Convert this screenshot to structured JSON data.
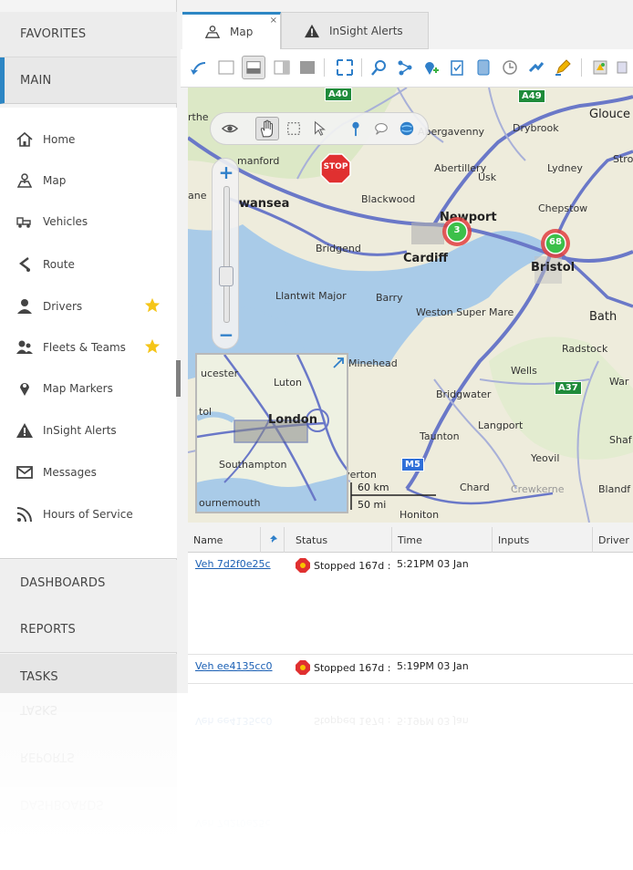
{
  "sidebar": {
    "favorites": "FAVORITES",
    "main": "MAIN",
    "items": [
      {
        "label": "Home",
        "icon": "home-icon"
      },
      {
        "label": "Map",
        "icon": "map-icon"
      },
      {
        "label": "Vehicles",
        "icon": "vehicles-icon"
      },
      {
        "label": "Route",
        "icon": "route-icon"
      },
      {
        "label": "Drivers",
        "icon": "driver-icon",
        "starred": true
      },
      {
        "label": "Fleets & Teams",
        "icon": "fleets-icon",
        "starred": true
      },
      {
        "label": "Map Markers",
        "icon": "map-marker-icon"
      },
      {
        "label": "InSight Alerts",
        "icon": "alert-icon"
      },
      {
        "label": "Messages",
        "icon": "envelope-icon"
      },
      {
        "label": "Hours of Service",
        "icon": "rss-icon"
      }
    ],
    "dashboards": "DASHBOARDS",
    "reports": "REPORTS",
    "tasks": "TASKS"
  },
  "tabs": {
    "map": "Map",
    "close": "×",
    "alerts": "InSight Alerts"
  },
  "map": {
    "stop_label": "STOP",
    "roads": {
      "a40": "A40",
      "a49": "A49",
      "a37": "A37",
      "m5": "M5"
    },
    "places": {
      "abergavenny": "Abergavenny",
      "glouce": "Glouce",
      "drybrook": "Drybrook",
      "rthe": "rthe",
      "manford": "manford",
      "abertillery": "Abertillery",
      "lydney": "Lydney",
      "stro": "Stro",
      "usk": "Usk",
      "wansea": "wansea",
      "blackwood": "Blackwood",
      "chepstow": "Chepstow",
      "newport": "Newport",
      "ane": "ane",
      "bridgend": "Bridgend",
      "cardiff": "Cardiff",
      "bristol": "Bristol",
      "llantwit": "Llantwit Major",
      "barry": "Barry",
      "weston": "Weston Super Mare",
      "bath": "Bath",
      "radstock": "Radstock",
      "minehead": "Minehead",
      "wells": "Wells",
      "war": "War",
      "bridgwater": "Bridgwater",
      "langport": "Langport",
      "taunton": "Taunton",
      "shaf": "Shaf",
      "yeovil": "Yeovil",
      "tiverton": "iverton",
      "chard": "Chard",
      "crewkerne": "Crewkerne",
      "blandf": "Blandf",
      "honiton": "Honiton"
    },
    "clusters": [
      {
        "count": "3",
        "color": "#3cc04a"
      },
      {
        "count": "68",
        "color": "#3cc04a"
      }
    ],
    "inset": {
      "cester": "ucester",
      "luton": "Luton",
      "tol": "tol",
      "london": "London",
      "southampton": "Southampton",
      "bournemouth": "ournemouth"
    },
    "scale_km": "60 km",
    "scale_mi": "50 mi"
  },
  "grid": {
    "columns": [
      "Name",
      "Status",
      "Time",
      "Inputs",
      "Driver"
    ],
    "rows": [
      {
        "name": "Veh 7d2f0e25c",
        "status": "Stopped 167d :",
        "time": "5:21PM 03 Jan"
      },
      {
        "name": "Veh ee4135cc0",
        "status": "Stopped 167d :",
        "time": "5:19PM 03 Jan"
      }
    ]
  },
  "colors": {
    "accent": "#2d86c4",
    "star": "#f5c518",
    "cluster_green": "#3cc04a",
    "stop_red": "#e03030"
  }
}
